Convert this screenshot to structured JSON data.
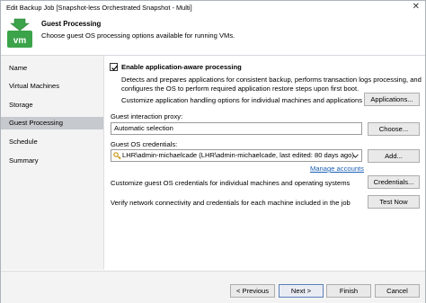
{
  "window": {
    "title": "Edit Backup Job [Snapshot-less Orchestrated Snapshot - Multi]",
    "close_icon": "✕"
  },
  "header": {
    "title": "Guest Processing",
    "subtitle": "Choose guest OS processing options available for running VMs.",
    "logo_text": "vm"
  },
  "sidebar": {
    "items": [
      {
        "label": "Name",
        "active": false
      },
      {
        "label": "Virtual Machines",
        "active": false
      },
      {
        "label": "Storage",
        "active": false
      },
      {
        "label": "Guest Processing",
        "active": true
      },
      {
        "label": "Schedule",
        "active": false
      },
      {
        "label": "Summary",
        "active": false
      }
    ]
  },
  "main": {
    "app_aware": {
      "label": "Enable application-aware processing",
      "checked": true,
      "description_line1": "Detects and prepares applications for consistent backup, performs transaction logs processing, and",
      "description_line2": "configures the OS to perform required application restore steps upon first boot.",
      "customize_text": "Customize application handling options for individual machines and applications",
      "button": "Applications..."
    },
    "interaction_proxy": {
      "label": "Guest interaction proxy:",
      "value": "Automatic selection",
      "button": "Choose..."
    },
    "credentials": {
      "label": "Guest OS credentials:",
      "value": "LHR\\admin-michaelcade (LHR\\admin-michaelcade, last edited: 80 days ago)",
      "button": "Add...",
      "manage_link": "Manage accounts"
    },
    "customize_credentials": {
      "text": "Customize guest OS credentials for individual machines and operating systems",
      "button": "Credentials..."
    },
    "verify": {
      "text": "Verify network connectivity and credentials for each machine included in the job",
      "button": "Test Now"
    }
  },
  "footer": {
    "previous": "< Previous",
    "next": "Next >",
    "finish": "Finish",
    "cancel": "Cancel"
  },
  "colors": {
    "accent": "#3ba34a",
    "selected_nav": "#c6c9cd",
    "link": "#1a5fb4"
  }
}
